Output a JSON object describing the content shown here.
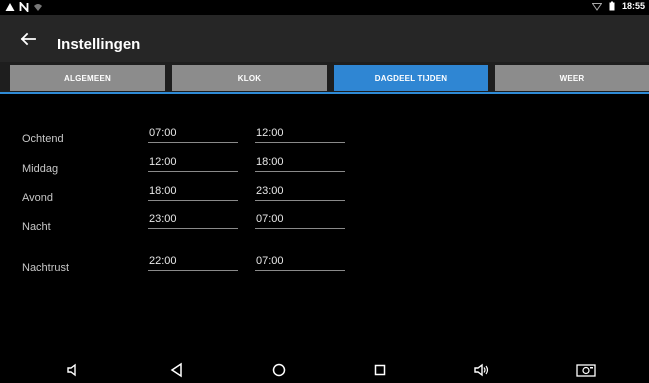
{
  "status_bar": {
    "time": "18:55",
    "icons": [
      "warning-icon",
      "n-notification-icon",
      "wifi-icon",
      "signal-icon",
      "battery-icon"
    ]
  },
  "app_bar": {
    "title": "Instellingen",
    "back_icon": "arrow-back-icon"
  },
  "tabs": [
    {
      "label": "ALGEMEEN",
      "active": false
    },
    {
      "label": "KLOK",
      "active": false
    },
    {
      "label": "DAGDEEL TIJDEN",
      "active": true
    },
    {
      "label": "WEER",
      "active": false
    }
  ],
  "rows": [
    {
      "label": "Ochtend",
      "start": "07:00",
      "end": "12:00"
    },
    {
      "label": "Middag",
      "start": "12:00",
      "end": "18:00"
    },
    {
      "label": "Avond",
      "start": "18:00",
      "end": "23:00"
    },
    {
      "label": "Nacht",
      "start": "23:00",
      "end": "07:00"
    },
    {
      "label": "Nachtrust",
      "start": "22:00",
      "end": "07:00"
    }
  ],
  "nav_bar": {
    "icons": [
      "volume-down-icon",
      "back-triangle-icon",
      "home-circle-icon",
      "recents-square-icon",
      "volume-up-icon",
      "screenshot-icon"
    ]
  },
  "colors": {
    "accent": "#2f86d3",
    "tab_inactive": "#8c8c8c",
    "app_bar": "#262626",
    "background": "#000000"
  }
}
